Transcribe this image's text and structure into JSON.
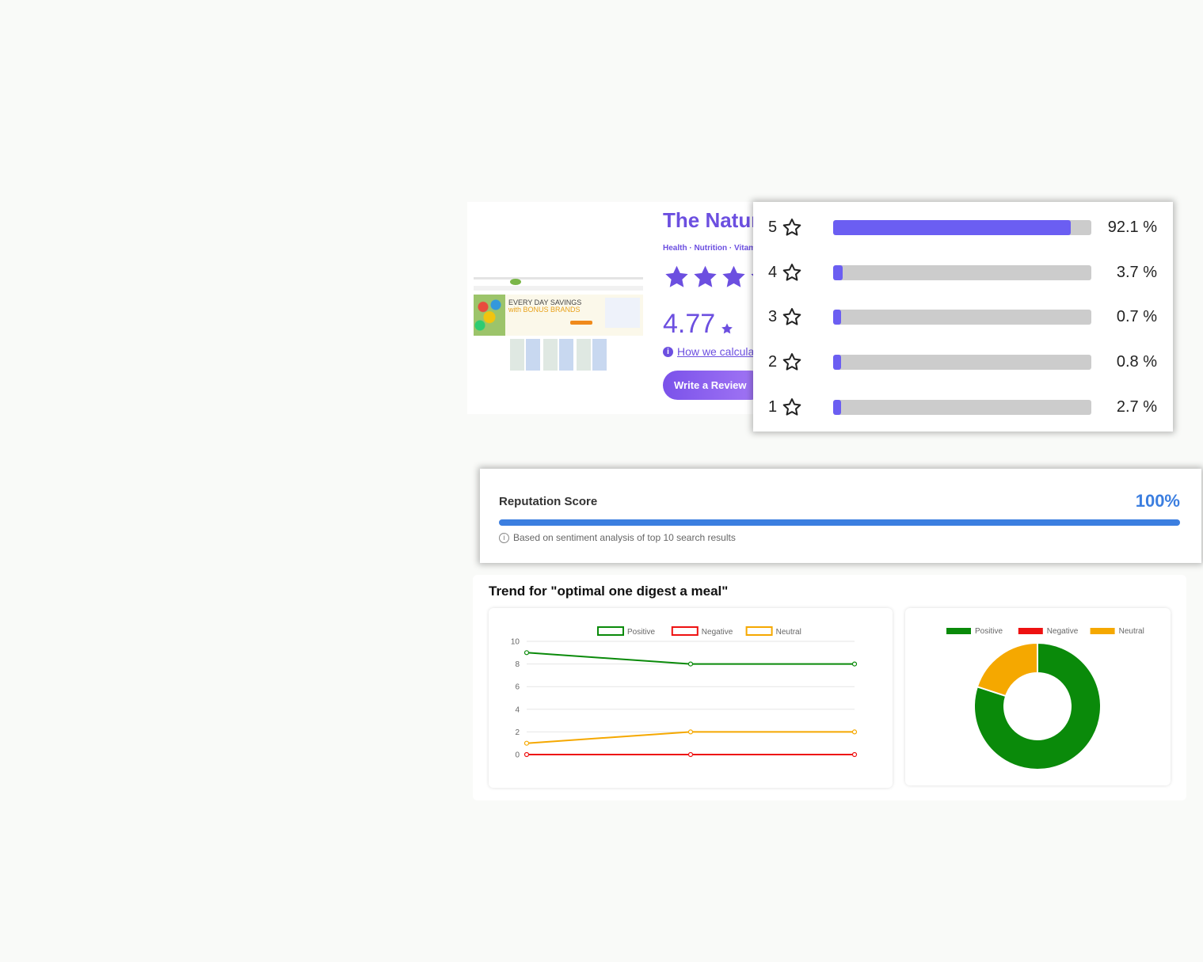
{
  "business": {
    "title": "The Natur",
    "categories": "Health · Nutrition · Vitami",
    "rating": "4.77",
    "rating_stars": 5,
    "how_calc": "How we calcula",
    "write_review": "Write a Review",
    "thumbnail": {
      "headline1": "EVERY DAY SAVINGS",
      "headline2": "with BONUS BRANDS"
    }
  },
  "distribution": [
    {
      "stars": "5",
      "percent": 92.1,
      "label": "92.1 %"
    },
    {
      "stars": "4",
      "percent": 3.7,
      "label": "3.7 %"
    },
    {
      "stars": "3",
      "percent": 0.7,
      "label": "0.7 %"
    },
    {
      "stars": "2",
      "percent": 0.8,
      "label": "0.8 %"
    },
    {
      "stars": "1",
      "percent": 2.7,
      "label": "2.7 %"
    }
  ],
  "reputation": {
    "title": "Reputation Score",
    "score": "100%",
    "score_value": 100,
    "note": "Based on sentiment analysis of top 10 search results"
  },
  "trend": {
    "title": "Trend for \"optimal one digest a meal\""
  },
  "colors": {
    "positive": "#0a8a0a",
    "negative": "#ee1111",
    "neutral": "#f5a800"
  },
  "chart_data": [
    {
      "type": "line",
      "x": [
        0,
        1,
        2
      ],
      "ylim": [
        0,
        10
      ],
      "yticks": [
        "0",
        "2",
        "4",
        "6",
        "8",
        "10"
      ],
      "grid": true,
      "legend": "top",
      "series": [
        {
          "name": "Positive",
          "values": [
            9,
            8,
            8
          ]
        },
        {
          "name": "Negative",
          "values": [
            0,
            0,
            0
          ]
        },
        {
          "name": "Neutral",
          "values": [
            1,
            2,
            2
          ]
        }
      ]
    },
    {
      "type": "pie",
      "legend": "top",
      "categories": [
        "Positive",
        "Negative",
        "Neutral"
      ],
      "values": [
        80,
        0,
        20
      ]
    }
  ]
}
